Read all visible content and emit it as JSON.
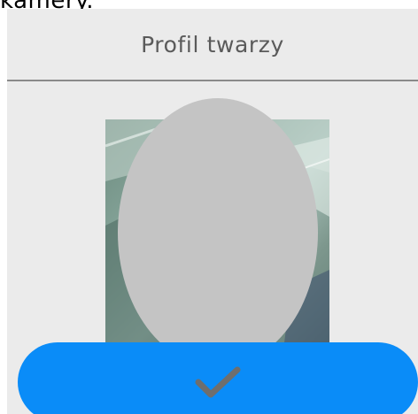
{
  "caption": {
    "fragment": "kamery."
  },
  "header": {
    "title": "Profil twarzy"
  },
  "face_capture": {
    "camera_icon": "camera-preview-image",
    "mask_shape": "oval-face-guide"
  },
  "confirm": {
    "icon": "check-icon"
  },
  "colors": {
    "background": "#ebebeb",
    "divider": "#8a8a8a",
    "mask": "#c4c4c4",
    "accent": "#0a8cf8",
    "check": "#6e6e6e"
  }
}
